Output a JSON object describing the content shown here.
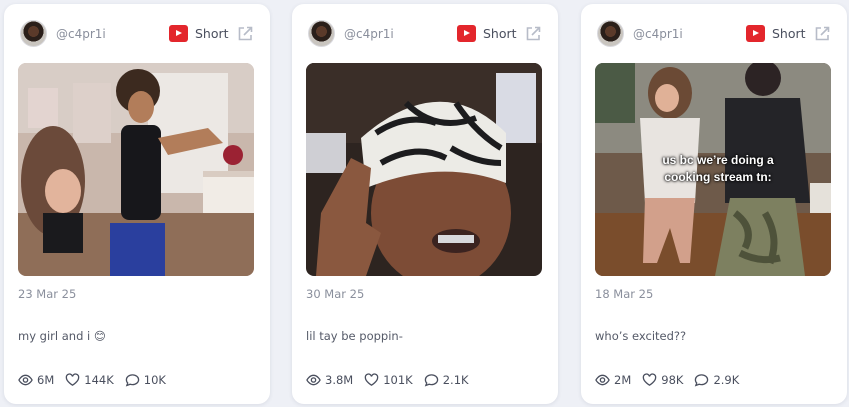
{
  "cards": [
    {
      "handle": "@c4pr1i",
      "type": "Short",
      "date": "23 Mar 25",
      "caption": "my girl and i 😊",
      "views": "6M",
      "likes": "144K",
      "comments": "10K",
      "overlay_text": ""
    },
    {
      "handle": "@c4pr1i",
      "type": "Short",
      "date": "30 Mar 25",
      "caption": "lil tay be poppin-",
      "views": "3.8M",
      "likes": "101K",
      "comments": "2.1K",
      "overlay_text": ""
    },
    {
      "handle": "@c4pr1i",
      "type": "Short",
      "date": "18 Mar 25",
      "caption": "who’s excited??",
      "views": "2M",
      "likes": "98K",
      "comments": "2.9K",
      "overlay_text": "us bc we’re doing a cooking stream tn:"
    }
  ],
  "icons": {
    "platform": "youtube-icon",
    "external": "external-link-icon",
    "views": "eye-icon",
    "likes": "heart-icon",
    "comments": "comment-icon"
  },
  "colors": {
    "youtube_red": "#e3262c",
    "background": "#eef0f6",
    "card": "#ffffff"
  }
}
